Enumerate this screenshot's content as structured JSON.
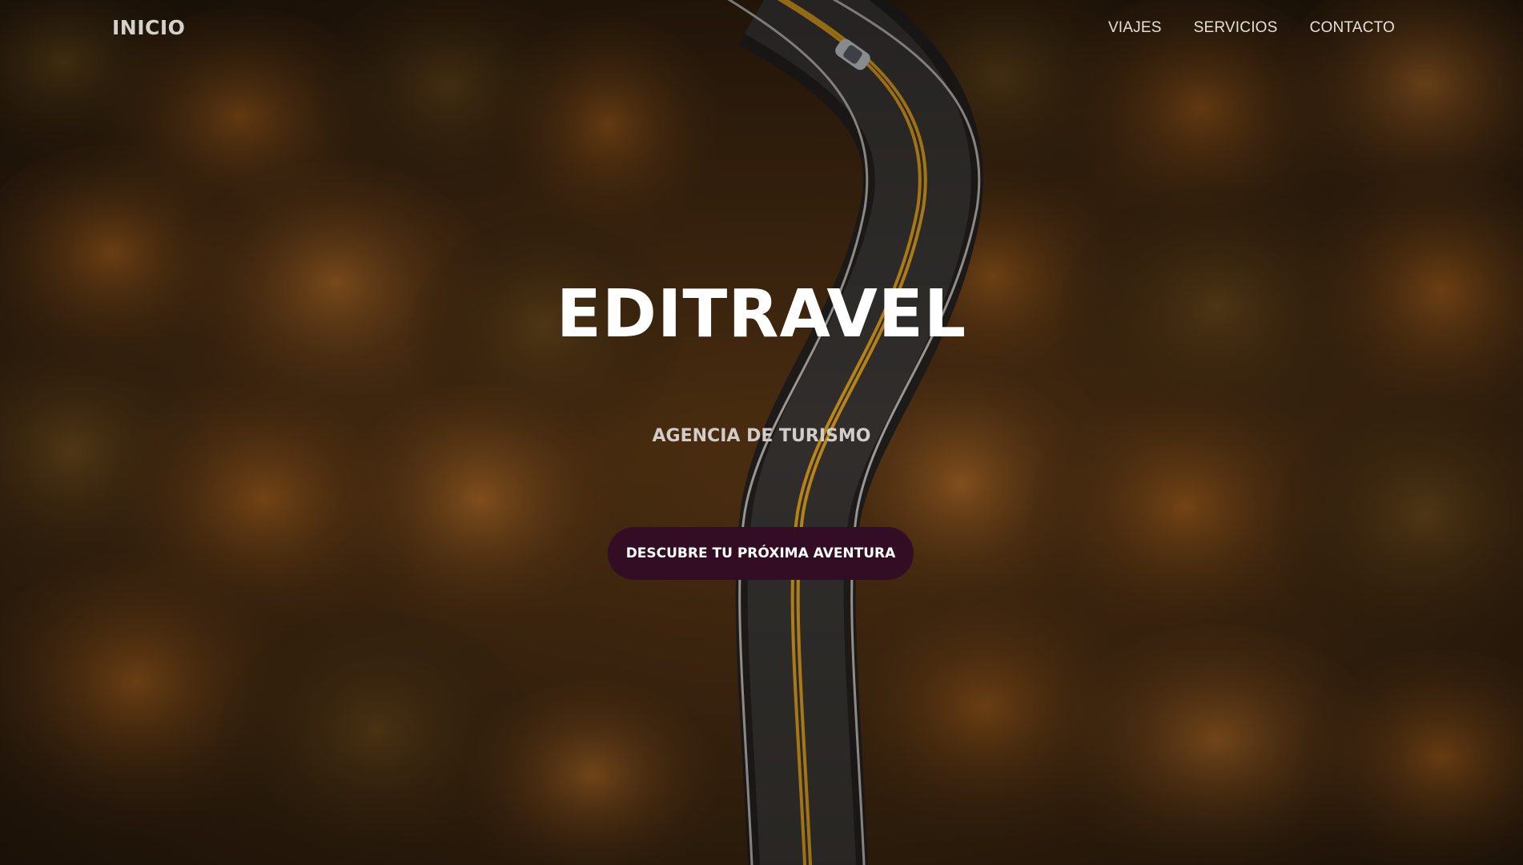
{
  "navbar": {
    "home_label": "INICIO",
    "links": [
      {
        "label": "VIAJES"
      },
      {
        "label": "SERVICIOS"
      },
      {
        "label": "CONTACTO"
      }
    ]
  },
  "hero": {
    "title": "EDITRAVEL",
    "subtitle": "AGENCIA DE TURISMO",
    "cta_label": "DESCUBRE TU PRÓXIMA AVENTURA"
  },
  "colors": {
    "cta_background": "#330d24",
    "foliage": "#6b3f17",
    "road_line": "#e0a020"
  }
}
